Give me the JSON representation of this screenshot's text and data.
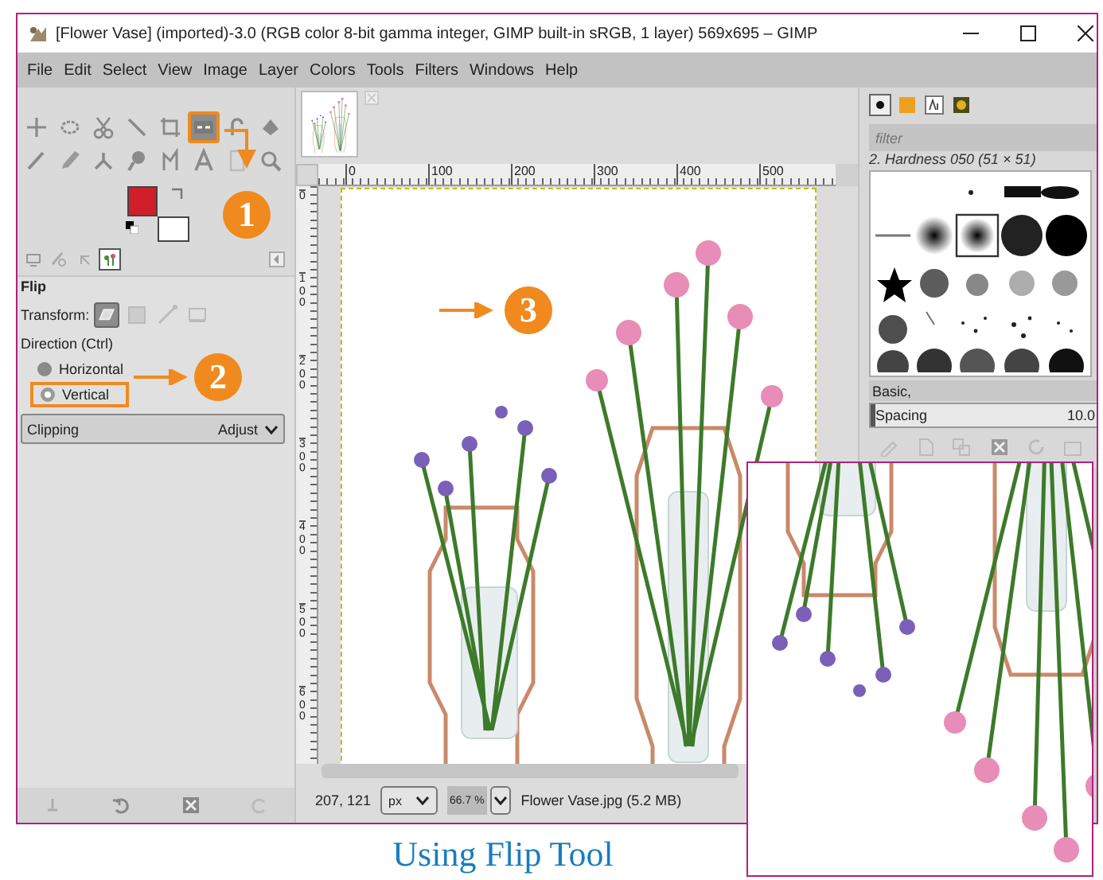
{
  "window": {
    "title": "[Flower Vase] (imported)-3.0 (RGB color 8-bit gamma integer, GIMP built-in sRGB, 1 layer) 569x695 – GIMP"
  },
  "menu": [
    "File",
    "Edit",
    "Select",
    "View",
    "Image",
    "Layer",
    "Colors",
    "Tools",
    "Filters",
    "Windows",
    "Help"
  ],
  "toolbox": {
    "tools": [
      {
        "selected": false,
        "highlighted": false
      },
      {
        "selected": false,
        "highlighted": false
      },
      {
        "selected": false,
        "highlighted": false
      },
      {
        "selected": false,
        "highlighted": false
      },
      {
        "selected": false,
        "highlighted": false
      },
      {
        "selected": true,
        "highlighted": true
      },
      {
        "selected": false,
        "highlighted": false
      },
      {
        "selected": false,
        "highlighted": false
      },
      {
        "selected": false,
        "highlighted": false
      },
      {
        "selected": false,
        "highlighted": false
      },
      {
        "selected": false,
        "highlighted": false
      },
      {
        "selected": false,
        "highlighted": false
      },
      {
        "selected": false,
        "highlighted": false
      },
      {
        "selected": false,
        "highlighted": false
      },
      {
        "selected": false,
        "highlighted": false
      },
      {
        "selected": false,
        "highlighted": false
      }
    ],
    "colors": [
      {
        "kind": "foreground",
        "color": "#d01f2a"
      },
      {
        "kind": "background",
        "color": "#ffffff"
      }
    ]
  },
  "dock_tabs": [
    {
      "selected": false
    },
    {
      "selected": false
    },
    {
      "selected": false
    },
    {
      "selected": true
    }
  ],
  "tool_options": {
    "title": "Flip",
    "transform_label": "Transform:",
    "transform_modes": [
      {
        "selected": true
      },
      {
        "selected": false
      },
      {
        "selected": false
      },
      {
        "selected": false
      }
    ],
    "direction_label": "Direction  (Ctrl)",
    "directions": [
      {
        "label": "Horizontal",
        "selected": false,
        "highlighted": false
      },
      {
        "label": "Vertical",
        "selected": true,
        "highlighted": true
      }
    ],
    "clipping": {
      "label": "Clipping",
      "value": "Adjust"
    }
  },
  "rulers": {
    "horizontal": [
      "0",
      "100",
      "200",
      "300",
      "400",
      "500"
    ],
    "vertical": [
      "0",
      "100",
      "200",
      "300",
      "400",
      "500",
      "600"
    ]
  },
  "status_bar": {
    "coordinates": "207, 121",
    "unit": "px",
    "zoom": "66.7 %",
    "file": "Flower Vase.jpg (5.2 MB)"
  },
  "brushes": {
    "tabs": [
      {
        "selected": true
      },
      {
        "selected": false
      },
      {
        "selected": false
      },
      {
        "selected": false
      }
    ],
    "filter_placeholder": "filter",
    "brush_name": "2. Hardness 050 (51 × 51)",
    "preset": "Basic,",
    "spacing_label": "Spacing",
    "spacing_value": "10.0",
    "level": 0.02
  },
  "callouts": [
    "1",
    "2",
    "3"
  ],
  "caption": "Using Flip Tool"
}
